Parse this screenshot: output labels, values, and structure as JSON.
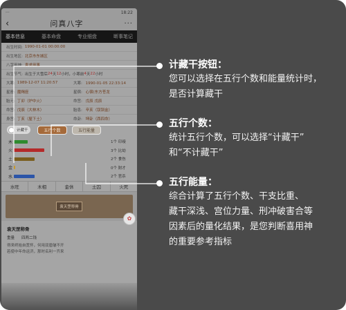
{
  "status": {
    "left": "···",
    "right": "18:22"
  },
  "app": {
    "back": "‹",
    "title": "问真八字",
    "more": "···"
  },
  "tabs": [
    "基本信息",
    "基本命盘",
    "专业细盘",
    "断事笔记"
  ],
  "info_rows": [
    {
      "label": "出生时间:",
      "value": "1990-01-01 00:00:00"
    },
    {
      "label": "出生地区:",
      "value": "北京市东城区"
    },
    {
      "label": "八字用神:",
      "value": "袁求用事"
    },
    {
      "label": "出生节气:",
      "pre": "出生于大雪后",
      "red1": "24",
      "mid1": "天",
      "red2": "12",
      "mid2": "小时，小寒前",
      "red3": "4",
      "mid3": "天",
      "red4": "22",
      "post": "小时"
    },
    {
      "label": "大寒:",
      "value": "1989-12-07 11:20:57",
      "label2": "大寒:",
      "value2": "1990-01-05 22:33:14"
    }
  ],
  "pair_rows": [
    {
      "l1": "星座:",
      "v1": "魔羯座",
      "l2": "星宿:",
      "v2": "心宿(东方苍龙"
    },
    {
      "l1": "胎元:",
      "v1": "丁卯（炉中火）",
      "l2": "命宫:",
      "v2": "戊辰 戊辰"
    },
    {
      "l1": "命宫:",
      "v1": "戊辰（大林木）",
      "l2": "胎息:",
      "v2": "辛亥（钗钏金）"
    },
    {
      "l1": "身宫:",
      "v1": "丁亥（屋下土）",
      "l2": "命卦:",
      "v2": "坤卦（西四命）"
    }
  ],
  "toggle": {
    "label": "计藏干"
  },
  "pills": {
    "count": "五行个数",
    "energy": "五行能量"
  },
  "elements": [
    {
      "name": "木",
      "color": "#2f8a2f",
      "fraction": 0.15,
      "count": "1个 印绶"
    },
    {
      "name": "火",
      "color": "#b42a2a",
      "fraction": 0.34,
      "count": "3个 比劫"
    },
    {
      "name": "土",
      "color": "#7a5e1e",
      "fraction": 0.23,
      "count": "2个 食伤"
    },
    {
      "name": "金",
      "color": "#c99a2a",
      "fraction": 0.0,
      "count": "0个 财才"
    },
    {
      "name": "水",
      "color": "#2c55a8",
      "fraction": 0.23,
      "count": "2个 官杀"
    }
  ],
  "states": [
    "水旺",
    "木相",
    "金休",
    "土囚",
    "火死"
  ],
  "banner": {
    "tag": "袁天罡称骨",
    "fab": "✿"
  },
  "article": {
    "title": "袁天罡称骨",
    "weight_label": "重量",
    "weight_value": "四两二钱",
    "body1": "得来终始自宽怀，何用双眉皱不开",
    "body2": "若使中年命运济，那时名利一齐来"
  },
  "callouts": [
    {
      "title": "计藏干按钮：",
      "lines": [
        "您可以选择在五行个数和能量统计时，",
        "是否计算藏干"
      ]
    },
    {
      "title": "五行个数：",
      "lines": [
        "统计五行个数，可以选择“计藏干”",
        "和“不计藏干”"
      ]
    },
    {
      "title": "五行能量：",
      "lines": [
        "综合计算了五行个数、干支比重、",
        "藏干深浅、宫位力量、刑冲破害合等",
        "因素后的量化结果，是您判断喜用神",
        "的重要参考指标"
      ]
    }
  ],
  "colors": {
    "background": "#4a4a4a",
    "phone_bg": "#a5a5a5",
    "tab_bar": "#161616",
    "accent": "#a56a3a",
    "callout_line": "#ffffff"
  }
}
